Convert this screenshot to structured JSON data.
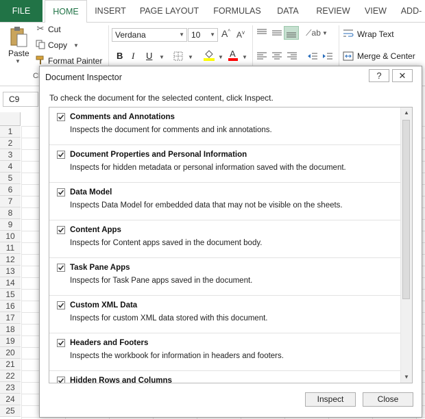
{
  "ribbon": {
    "tabs": [
      "FILE",
      "HOME",
      "INSERT",
      "PAGE LAYOUT",
      "FORMULAS",
      "DATA",
      "REVIEW",
      "VIEW",
      "ADD-"
    ],
    "active_tab": "HOME",
    "clipboard": {
      "paste_label": "Paste",
      "cut_label": "Cut",
      "copy_label": "Copy",
      "format_painter_label": "Format Painter",
      "group_label_partial": "Cl"
    },
    "font": {
      "name": "Verdana",
      "size": "10",
      "bold": "B",
      "italic": "I",
      "underline": "U"
    },
    "alignment": {
      "wrap_text_label": "Wrap Text",
      "merge_center_label": "Merge & Center"
    },
    "colors": {
      "accent": "#217346",
      "highlight": "#ffff00",
      "font_color": "#ff0000"
    }
  },
  "formula_bar": {
    "name_box": "C9"
  },
  "grid": {
    "row_headers": [
      "1",
      "2",
      "3",
      "4",
      "5",
      "6",
      "7",
      "8",
      "9",
      "10",
      "11",
      "12",
      "13",
      "14",
      "15",
      "16",
      "17",
      "18",
      "19",
      "20",
      "21",
      "22",
      "23",
      "24",
      "25"
    ]
  },
  "dialog": {
    "title": "Document Inspector",
    "help_label": "?",
    "close_glyph": "✕",
    "instruction": "To check the document for the selected content, click Inspect.",
    "items": [
      {
        "title": "Comments and Annotations",
        "desc": "Inspects the document for comments and ink annotations.",
        "checked": true
      },
      {
        "title": "Document Properties and Personal Information",
        "desc": "Inspects for hidden metadata or personal information saved with the document.",
        "checked": true
      },
      {
        "title": "Data Model",
        "desc": "Inspects Data Model for embedded data that may not be visible on the sheets.",
        "checked": true
      },
      {
        "title": "Content Apps",
        "desc": "Inspects for Content apps saved in the document body.",
        "checked": true
      },
      {
        "title": "Task Pane Apps",
        "desc": "Inspects for Task Pane apps saved in the document.",
        "checked": true
      },
      {
        "title": "Custom XML Data",
        "desc": "Inspects for custom XML data stored with this document.",
        "checked": true
      },
      {
        "title": "Headers and Footers",
        "desc": "Inspects the workbook for information in headers and footers.",
        "checked": true
      },
      {
        "title": "Hidden Rows and Columns",
        "desc": "",
        "checked": true
      }
    ],
    "inspect_label": "Inspect",
    "close_label": "Close"
  }
}
